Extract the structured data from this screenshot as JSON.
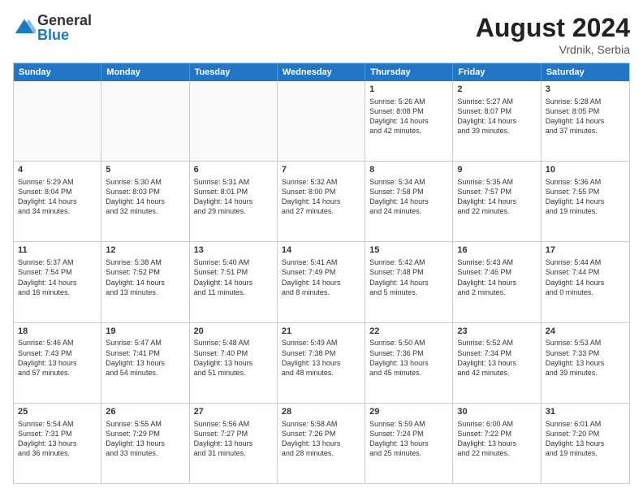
{
  "header": {
    "logo_general": "General",
    "logo_blue": "Blue",
    "month_year": "August 2024",
    "location": "Vrdnik, Serbia"
  },
  "weekdays": [
    "Sunday",
    "Monday",
    "Tuesday",
    "Wednesday",
    "Thursday",
    "Friday",
    "Saturday"
  ],
  "rows": [
    [
      {
        "day": "",
        "empty": true
      },
      {
        "day": "",
        "empty": true
      },
      {
        "day": "",
        "empty": true
      },
      {
        "day": "",
        "empty": true
      },
      {
        "day": "1",
        "lines": [
          "Sunrise: 5:26 AM",
          "Sunset: 8:08 PM",
          "Daylight: 14 hours",
          "and 42 minutes."
        ]
      },
      {
        "day": "2",
        "lines": [
          "Sunrise: 5:27 AM",
          "Sunset: 8:07 PM",
          "Daylight: 14 hours",
          "and 39 minutes."
        ]
      },
      {
        "day": "3",
        "lines": [
          "Sunrise: 5:28 AM",
          "Sunset: 8:05 PM",
          "Daylight: 14 hours",
          "and 37 minutes."
        ]
      }
    ],
    [
      {
        "day": "4",
        "lines": [
          "Sunrise: 5:29 AM",
          "Sunset: 8:04 PM",
          "Daylight: 14 hours",
          "and 34 minutes."
        ]
      },
      {
        "day": "5",
        "lines": [
          "Sunrise: 5:30 AM",
          "Sunset: 8:03 PM",
          "Daylight: 14 hours",
          "and 32 minutes."
        ]
      },
      {
        "day": "6",
        "lines": [
          "Sunrise: 5:31 AM",
          "Sunset: 8:01 PM",
          "Daylight: 14 hours",
          "and 29 minutes."
        ]
      },
      {
        "day": "7",
        "lines": [
          "Sunrise: 5:32 AM",
          "Sunset: 8:00 PM",
          "Daylight: 14 hours",
          "and 27 minutes."
        ]
      },
      {
        "day": "8",
        "lines": [
          "Sunrise: 5:34 AM",
          "Sunset: 7:58 PM",
          "Daylight: 14 hours",
          "and 24 minutes."
        ]
      },
      {
        "day": "9",
        "lines": [
          "Sunrise: 5:35 AM",
          "Sunset: 7:57 PM",
          "Daylight: 14 hours",
          "and 22 minutes."
        ]
      },
      {
        "day": "10",
        "lines": [
          "Sunrise: 5:36 AM",
          "Sunset: 7:55 PM",
          "Daylight: 14 hours",
          "and 19 minutes."
        ]
      }
    ],
    [
      {
        "day": "11",
        "lines": [
          "Sunrise: 5:37 AM",
          "Sunset: 7:54 PM",
          "Daylight: 14 hours",
          "and 16 minutes."
        ]
      },
      {
        "day": "12",
        "lines": [
          "Sunrise: 5:38 AM",
          "Sunset: 7:52 PM",
          "Daylight: 14 hours",
          "and 13 minutes."
        ]
      },
      {
        "day": "13",
        "lines": [
          "Sunrise: 5:40 AM",
          "Sunset: 7:51 PM",
          "Daylight: 14 hours",
          "and 11 minutes."
        ]
      },
      {
        "day": "14",
        "lines": [
          "Sunrise: 5:41 AM",
          "Sunset: 7:49 PM",
          "Daylight: 14 hours",
          "and 8 minutes."
        ]
      },
      {
        "day": "15",
        "lines": [
          "Sunrise: 5:42 AM",
          "Sunset: 7:48 PM",
          "Daylight: 14 hours",
          "and 5 minutes."
        ]
      },
      {
        "day": "16",
        "lines": [
          "Sunrise: 5:43 AM",
          "Sunset: 7:46 PM",
          "Daylight: 14 hours",
          "and 2 minutes."
        ]
      },
      {
        "day": "17",
        "lines": [
          "Sunrise: 5:44 AM",
          "Sunset: 7:44 PM",
          "Daylight: 14 hours",
          "and 0 minutes."
        ]
      }
    ],
    [
      {
        "day": "18",
        "lines": [
          "Sunrise: 5:46 AM",
          "Sunset: 7:43 PM",
          "Daylight: 13 hours",
          "and 57 minutes."
        ]
      },
      {
        "day": "19",
        "lines": [
          "Sunrise: 5:47 AM",
          "Sunset: 7:41 PM",
          "Daylight: 13 hours",
          "and 54 minutes."
        ]
      },
      {
        "day": "20",
        "lines": [
          "Sunrise: 5:48 AM",
          "Sunset: 7:40 PM",
          "Daylight: 13 hours",
          "and 51 minutes."
        ]
      },
      {
        "day": "21",
        "lines": [
          "Sunrise: 5:49 AM",
          "Sunset: 7:38 PM",
          "Daylight: 13 hours",
          "and 48 minutes."
        ]
      },
      {
        "day": "22",
        "lines": [
          "Sunrise: 5:50 AM",
          "Sunset: 7:36 PM",
          "Daylight: 13 hours",
          "and 45 minutes."
        ]
      },
      {
        "day": "23",
        "lines": [
          "Sunrise: 5:52 AM",
          "Sunset: 7:34 PM",
          "Daylight: 13 hours",
          "and 42 minutes."
        ]
      },
      {
        "day": "24",
        "lines": [
          "Sunrise: 5:53 AM",
          "Sunset: 7:33 PM",
          "Daylight: 13 hours",
          "and 39 minutes."
        ]
      }
    ],
    [
      {
        "day": "25",
        "lines": [
          "Sunrise: 5:54 AM",
          "Sunset: 7:31 PM",
          "Daylight: 13 hours",
          "and 36 minutes."
        ]
      },
      {
        "day": "26",
        "lines": [
          "Sunrise: 5:55 AM",
          "Sunset: 7:29 PM",
          "Daylight: 13 hours",
          "and 33 minutes."
        ]
      },
      {
        "day": "27",
        "lines": [
          "Sunrise: 5:56 AM",
          "Sunset: 7:27 PM",
          "Daylight: 13 hours",
          "and 31 minutes."
        ]
      },
      {
        "day": "28",
        "lines": [
          "Sunrise: 5:58 AM",
          "Sunset: 7:26 PM",
          "Daylight: 13 hours",
          "and 28 minutes."
        ]
      },
      {
        "day": "29",
        "lines": [
          "Sunrise: 5:59 AM",
          "Sunset: 7:24 PM",
          "Daylight: 13 hours",
          "and 25 minutes."
        ]
      },
      {
        "day": "30",
        "lines": [
          "Sunrise: 6:00 AM",
          "Sunset: 7:22 PM",
          "Daylight: 13 hours",
          "and 22 minutes."
        ]
      },
      {
        "day": "31",
        "lines": [
          "Sunrise: 6:01 AM",
          "Sunset: 7:20 PM",
          "Daylight: 13 hours",
          "and 19 minutes."
        ]
      }
    ]
  ]
}
